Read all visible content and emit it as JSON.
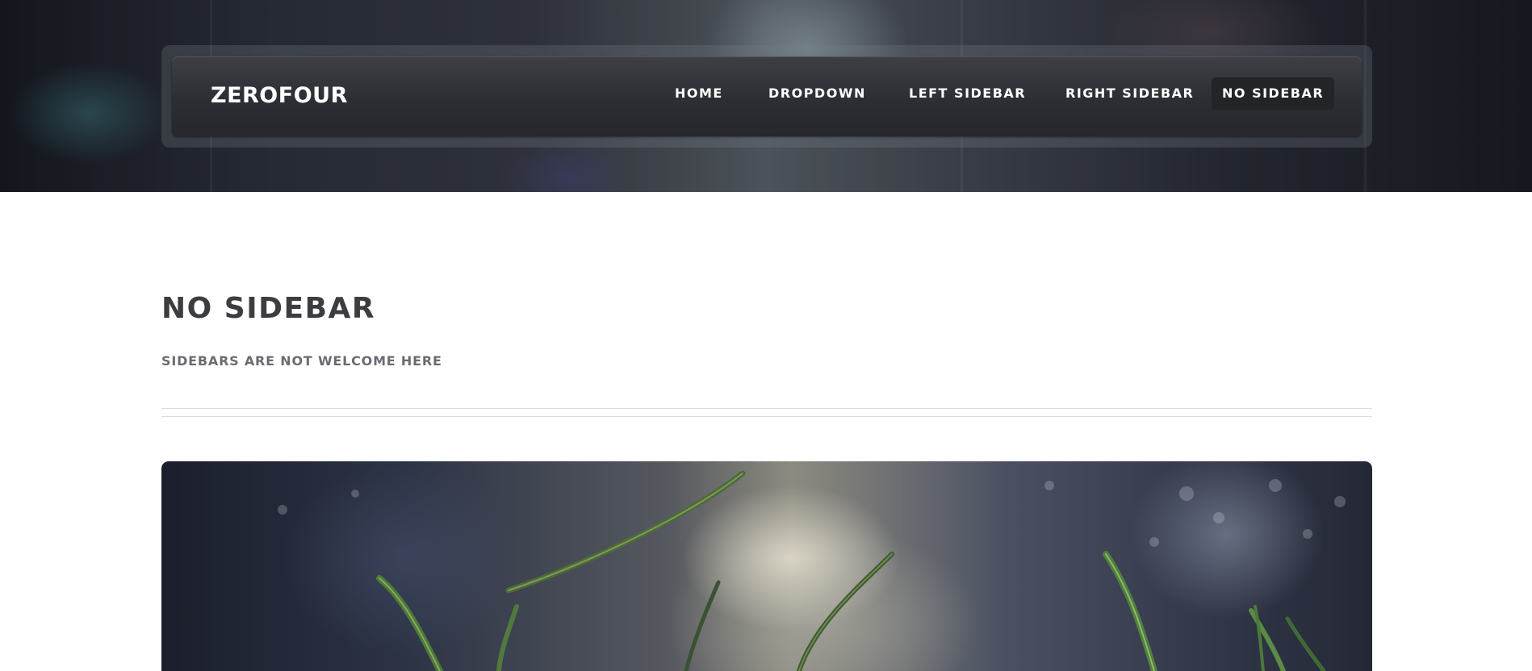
{
  "header": {
    "logo": "ZEROFOUR",
    "nav": [
      {
        "label": "HOME",
        "active": false
      },
      {
        "label": "DROPDOWN",
        "active": false
      },
      {
        "label": "LEFT SIDEBAR",
        "active": false
      },
      {
        "label": "RIGHT SIDEBAR",
        "active": false
      },
      {
        "label": "NO SIDEBAR",
        "active": true
      }
    ]
  },
  "main": {
    "title": "NO SIDEBAR",
    "subtitle": "SIDEBARS ARE NOT WELCOME HERE"
  },
  "colors": {
    "title": "#3b3d41",
    "subtitle": "#6a6c70",
    "nav_active_bg": "#232427"
  }
}
